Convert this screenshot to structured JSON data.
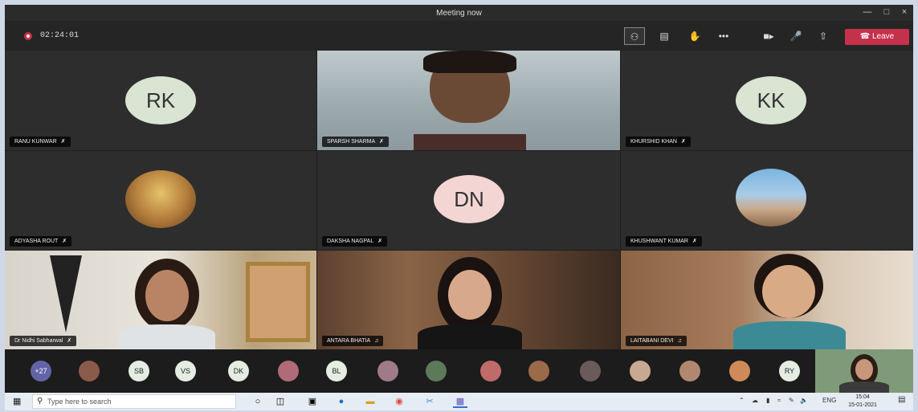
{
  "window": {
    "title": "Meeting now"
  },
  "toolbar": {
    "timer": "02:24:01",
    "leave_label": "Leave",
    "more_label": "•••",
    "leave_color": "#c4314b"
  },
  "participants": [
    {
      "name": "RANU KUNWAR",
      "initials": "RK"
    },
    {
      "name": "SPARSH SHARMA"
    },
    {
      "name": "KHURSHID KHAN",
      "initials": "KK"
    },
    {
      "name": "ADYASHA ROUT"
    },
    {
      "name": "DAKSHA NAGPAL",
      "initials": "DN"
    },
    {
      "name": "KHUSHWANT KUMAR"
    },
    {
      "name": "Dr Nidhi Sabharwal"
    },
    {
      "name": "ANTARA BHATIA"
    },
    {
      "name": "LAITABANI DEVI"
    }
  ],
  "roster": {
    "overflow_count": "+27",
    "chips": [
      "SB",
      "VS",
      "DK",
      "BL",
      "RY"
    ]
  },
  "taskbar": {
    "search_placeholder": "Type here to search",
    "lang": "ENG",
    "time": "15:04",
    "date": "15-01-2021"
  }
}
